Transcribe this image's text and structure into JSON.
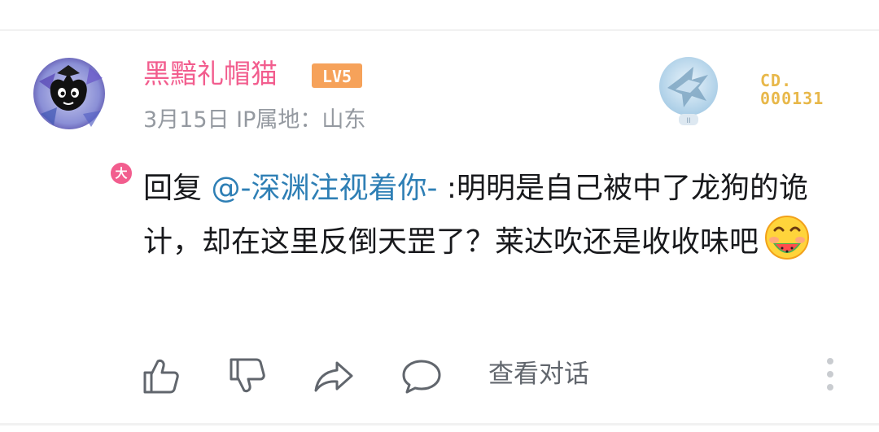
{
  "comment": {
    "user": {
      "name": "黑黯礼帽猫",
      "level": "LV5",
      "avatar_badge": "大"
    },
    "meta": "3月15日 IP属地：山东",
    "pendant": {
      "number_line1": "CD.",
      "number_line2": "000131"
    },
    "reply_prefix": "回复 ",
    "mention": "@-深渊注视着你-",
    "body": " :明明是自己被中了龙狗的诡计，却在这里反倒天罡了？莱达吹还是收收味吧",
    "actions": {
      "view_conversation": "查看对话"
    }
  },
  "colors": {
    "username": "#f25d8e",
    "mention": "#2e7fb5",
    "meta": "#9499a0",
    "level_badge": "#f6a25a",
    "pendant_number": "#e8b84a"
  }
}
